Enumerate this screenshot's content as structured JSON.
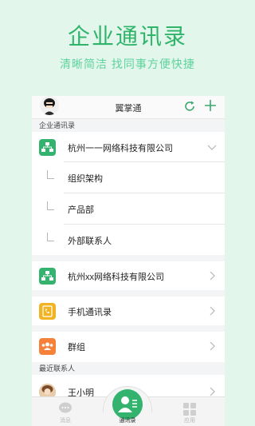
{
  "promo": {
    "title": "企业通讯录",
    "subtitle": "清晰简洁  找同事方便快捷"
  },
  "header": {
    "title": "翼掌通",
    "refresh_icon": "refresh-icon",
    "add_icon": "plus-icon"
  },
  "sections": {
    "enterprise_label": "企业通讯录",
    "recent_label": "最近联系人"
  },
  "enterprise": {
    "company1": "杭州一一网络科技有限公司",
    "subitems": [
      "组织架构",
      "产品部",
      "外部联系人"
    ],
    "company2": "杭州xx网络科技有限公司",
    "phone_contacts": "手机通讯录",
    "groups": "群组"
  },
  "recent": {
    "contact1": "王小明"
  },
  "tabbar": {
    "tab_messages": "消息",
    "tab_contacts": "通讯录",
    "tab_apps": "应用"
  },
  "colors": {
    "accent": "#34b36f",
    "orange": "#f5813a",
    "yellow": "#f1b322"
  }
}
